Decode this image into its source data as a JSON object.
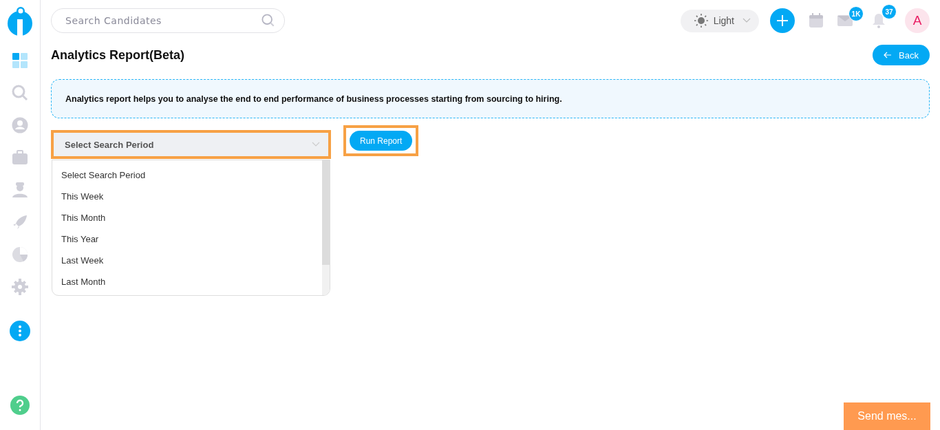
{
  "sidebar": {
    "items": [
      {
        "selected": true
      },
      {
        "selected": false
      },
      {
        "selected": false
      },
      {
        "selected": false
      },
      {
        "selected": false
      },
      {
        "selected": false
      },
      {
        "selected": false
      },
      {
        "selected": false
      }
    ]
  },
  "topbar": {
    "search": {
      "placeholder": "Search Candidates"
    },
    "theme": {
      "label": "Light"
    },
    "mail_badge": "1K",
    "bell_badge": "37",
    "avatar": "A"
  },
  "page": {
    "title": "Analytics Report(Beta)",
    "back": "Back",
    "info": "Analytics report helps you to analyse the end to end performance of business processes starting from sourcing to hiring."
  },
  "period_select": {
    "value": "Select Search Period",
    "highlighted": true,
    "expanded": true,
    "options": [
      "Select Search Period",
      "This Week",
      "This Month",
      "This Year",
      "Last Week",
      "Last Month"
    ]
  },
  "run_button": {
    "label": "Run Report",
    "highlighted": true
  },
  "chat": {
    "label": "Send mes..."
  }
}
